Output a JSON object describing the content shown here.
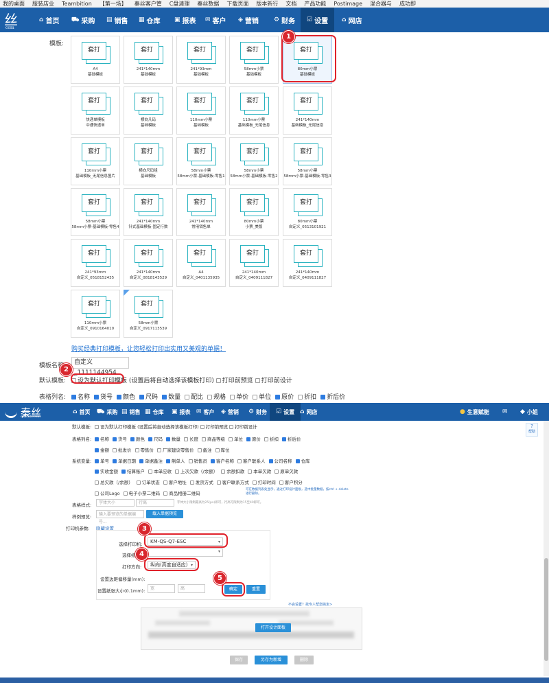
{
  "bookmarks": [
    "我的桌面",
    "服装店业",
    "Teambition",
    "【第一场】",
    "秦丝客户管",
    "C盘清理",
    "秦丝数据",
    "下载页面",
    "版本新行",
    "文档",
    "产品功能",
    "Postimage",
    "混合器与",
    "成功即"
  ],
  "top_nav": {
    "logo_text": "丝",
    "logo_sub": "com",
    "items": [
      {
        "icon": "home-icon",
        "label": "首页"
      },
      {
        "icon": "cart-icon",
        "label": "采购"
      },
      {
        "icon": "chart-icon",
        "label": "销售"
      },
      {
        "icon": "warehouse-icon",
        "label": "仓库"
      },
      {
        "icon": "report-icon",
        "label": "报表"
      },
      {
        "icon": "mail-icon",
        "label": "客户"
      },
      {
        "icon": "tag-icon",
        "label": "营销"
      },
      {
        "icon": "gear-icon",
        "label": "财务"
      },
      {
        "icon": "settings-icon",
        "label": "设置"
      },
      {
        "icon": "shop-icon",
        "label": "网店"
      }
    ]
  },
  "templates": {
    "label": "模板:",
    "tile_text": "套打",
    "items": [
      {
        "l1": "A4",
        "l2": "基础模板"
      },
      {
        "l1": "241*140mm",
        "l2": "基础模板"
      },
      {
        "l1": "241*93mm",
        "l2": "基础模板"
      },
      {
        "l1": "58mm小票",
        "l2": "基础模板"
      },
      {
        "l1": "80mm小票",
        "l2": "基础模板"
      },
      {
        "l1": "快递单模板",
        "l2": "中通快递单"
      },
      {
        "l1": "横向凡码",
        "l2": "基础模板"
      },
      {
        "l1": "110mm小票",
        "l2": "基础模板"
      },
      {
        "l1": "110mm小票",
        "l2": "基础模板_无尾信息"
      },
      {
        "l1": "241*140mm",
        "l2": "基础模板_无尾信息"
      },
      {
        "l1": "110mm小票",
        "l2": "基础模板_无尾信息图片"
      },
      {
        "l1": "横向尺码组",
        "l2": "基础模板"
      },
      {
        "l1": "58mm小票",
        "l2": "58mm小票-基础模板-零售1"
      },
      {
        "l1": "58mm小票",
        "l2": "58mm小票-基础模板-零售2"
      },
      {
        "l1": "58mm小票",
        "l2": "58mm小票-基础模板-零售3"
      },
      {
        "l1": "58mm小票",
        "l2": "58mm小票-基础模板-零售4"
      },
      {
        "l1": "241*140mm",
        "l2": "针式基础模板-固定行数"
      },
      {
        "l1": "241*140mm",
        "l2": "常用销售单"
      },
      {
        "l1": "80mm小票",
        "l2": "小票_美版"
      },
      {
        "l1": "80mm小票",
        "l2": "自定义_0513101921"
      },
      {
        "l1": "241*93mm",
        "l2": "自定义_0518152435"
      },
      {
        "l1": "241*140mm",
        "l2": "自定义_0818143529"
      },
      {
        "l1": "A4",
        "l2": "自定义_0401135935"
      },
      {
        "l1": "241*140mm",
        "l2": "自定义_0409111827"
      },
      {
        "l1": "241*140mm",
        "l2": "自定义_0409111827"
      },
      {
        "l1": "110mm小票",
        "l2": "自定义_0910164010"
      },
      {
        "l1": "58mm小票",
        "l2": "自定义_0917113539"
      }
    ]
  },
  "buy_link": "购买经典打印模板，让您轻松打印出实用又美观的单据！",
  "template_name": {
    "label": "模板名称:",
    "value": "自定义_1111144954"
  },
  "default_template": {
    "label": "默认模板:",
    "option": "设为默认打印模板",
    "note": "(设置后将自动选择该模板打印)",
    "preview": "打印前预览",
    "design": "打印前设计"
  },
  "table_columns": {
    "label": "表格列名:",
    "items": [
      {
        "t": "名称",
        "on": true
      },
      {
        "t": "货号",
        "on": true
      },
      {
        "t": "颜色",
        "on": true
      },
      {
        "t": "尺码",
        "on": true
      },
      {
        "t": "数量",
        "on": true
      },
      {
        "t": "配比",
        "on": false
      },
      {
        "t": "规格",
        "on": false
      },
      {
        "t": "单价",
        "on": false
      },
      {
        "t": "单位",
        "on": false
      },
      {
        "t": "原价",
        "on": true
      },
      {
        "t": "折扣",
        "on": false
      },
      {
        "t": "折后价",
        "on": true
      }
    ]
  },
  "second_nav": {
    "logo_text": "秦丝",
    "logo_sub": "qinsilk.com",
    "items": [
      {
        "icon": "home-icon",
        "label": "首页"
      },
      {
        "icon": "cart-icon",
        "label": "采购"
      },
      {
        "icon": "chart-icon",
        "label": "销售"
      },
      {
        "icon": "warehouse-icon",
        "label": "仓库"
      },
      {
        "icon": "report-icon",
        "label": "报表"
      },
      {
        "icon": "mail-icon",
        "label": "客户"
      },
      {
        "icon": "tag-icon",
        "label": "营销"
      },
      {
        "icon": "gear-icon",
        "label": "财务"
      },
      {
        "icon": "settings-icon",
        "label": "设置"
      },
      {
        "icon": "shop-icon",
        "label": "网店"
      }
    ],
    "biz": "生意赋能",
    "user": "小姐",
    "help": "帮助"
  },
  "lower": {
    "default_label": "默认模板:",
    "default_text": "设为默认打印模板 (设置后将自动选择该模板打印)",
    "preview": "打印前预览",
    "design": "打印前设计",
    "cols_label": "表格列名:",
    "cols_row1": [
      {
        "t": "名称",
        "on": true
      },
      {
        "t": "货号",
        "on": true
      },
      {
        "t": "颜色",
        "on": true
      },
      {
        "t": "尺码",
        "on": true
      },
      {
        "t": "数量",
        "on": true
      },
      {
        "t": "长度",
        "on": false
      },
      {
        "t": "商品等级",
        "on": false
      },
      {
        "t": "单位",
        "on": false
      },
      {
        "t": "原价",
        "on": true
      },
      {
        "t": "折扣",
        "on": false
      },
      {
        "t": "折后价",
        "on": true
      }
    ],
    "cols_row2": [
      {
        "t": "金额",
        "on": true
      },
      {
        "t": "批发价",
        "on": false
      },
      {
        "t": "零售价",
        "on": false
      },
      {
        "t": "厂家建议零售价",
        "on": false
      },
      {
        "t": "备注",
        "on": false
      },
      {
        "t": "库位",
        "on": false
      }
    ],
    "sys_label": "系统变量:",
    "sys_row1": [
      {
        "t": "单号",
        "on": true
      },
      {
        "t": "单据日期",
        "on": true
      },
      {
        "t": "单据备注",
        "on": true
      },
      {
        "t": "制单人",
        "on": true
      },
      {
        "t": "销售员",
        "on": false
      },
      {
        "t": "客户名称",
        "on": true
      },
      {
        "t": "客户联系人",
        "on": false
      },
      {
        "t": "公司名称",
        "on": true
      },
      {
        "t": "仓库",
        "on": true
      }
    ],
    "sys_row2": [
      {
        "t": "实收金额",
        "on": true
      },
      {
        "t": "结算账户",
        "on": true
      },
      {
        "t": "本单应收",
        "on": false
      },
      {
        "t": "上次欠款（/余额）",
        "on": false
      },
      {
        "t": "余额扣款",
        "on": false
      },
      {
        "t": "本单欠款",
        "on": false
      },
      {
        "t": "原单欠款",
        "on": false
      }
    ],
    "sys_row3": [
      {
        "t": "总欠款（/余额）",
        "on": false
      },
      {
        "t": "订单状态",
        "on": false
      },
      {
        "t": "客户地址",
        "on": false
      },
      {
        "t": "发货方式",
        "on": false
      },
      {
        "t": "客户联系方式",
        "on": false
      },
      {
        "t": "打印时间",
        "on": false
      },
      {
        "t": "客户积分",
        "on": false
      }
    ],
    "sys_row4": [
      {
        "t": "公司Logo",
        "on": false
      },
      {
        "t": "电子小票二维码",
        "on": false
      },
      {
        "t": "商品相册二维码",
        "on": false
      }
    ],
    "sys_note": "可在数据列表处显示，通过打印设计面板，选中批量数据，按ctrl + delete 进行删除。",
    "style_label": "表格样式:",
    "font_ph": "字体大小",
    "row_ph": "行高",
    "style_note": "字体大小限制最高为25(px)即可，行高可限制为15至40即可。",
    "sample_label": "样例预览:",
    "sample_ph": "输入要预览的单据编号...",
    "sample_btn": "载入单据预览",
    "printer_label": "打印机参数:",
    "hide_link": "隐藏设置",
    "printer_sel_label": "选择打印机:",
    "printer_value": "KM-QS-Q7-ESC",
    "paper_label": "选择纸",
    "direction_label": "打印方向:",
    "direction_value": "纵向(高度自适应)",
    "offset_label": "设置边距偏移量(mm):",
    "paper_size_label": "设置纸张大小(0.1mm):",
    "width_ph": "宽",
    "height_ph": "高",
    "confirm_btn": "确定",
    "reset_btn": "重置",
    "help_link": "不会设置？找专人帮您搞定>",
    "design_btn": "打开设计面板",
    "save_btn": "保存",
    "save_new_btn": "另存为新增",
    "delete_btn": "删除"
  },
  "annotations": [
    "1",
    "2",
    "3",
    "4",
    "5"
  ],
  "colors": {
    "nav": "#1c5fa8",
    "accent": "#2a90d8",
    "highlight": "#e0222b",
    "tile": "#2ab3c0"
  }
}
